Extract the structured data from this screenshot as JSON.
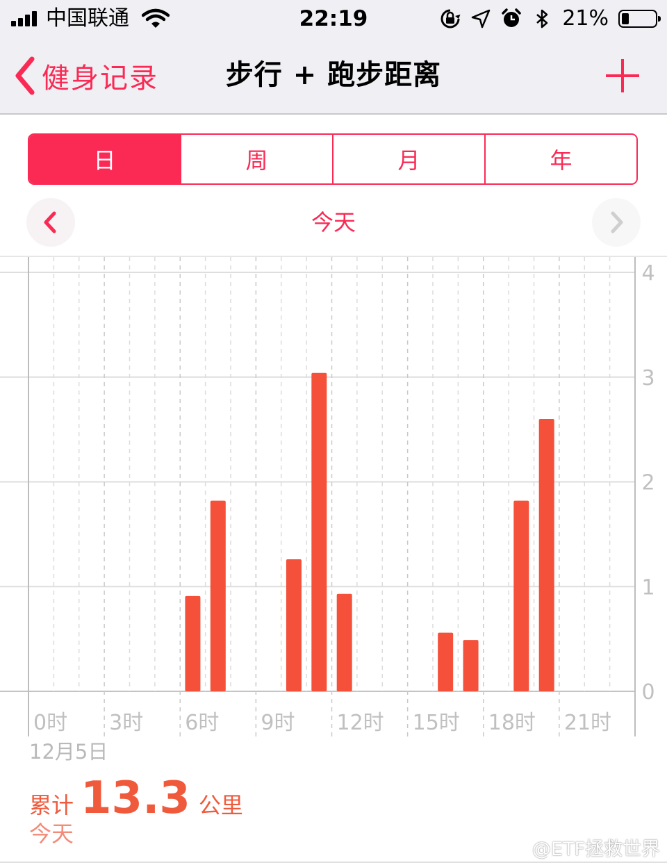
{
  "status_bar": {
    "carrier": "中国联通",
    "time": "22:19",
    "battery_percent": "21%",
    "battery_level": 0.21,
    "icons": [
      "signal-icon",
      "wifi-icon",
      "rotation-lock-icon",
      "location-icon",
      "alarm-icon",
      "bluetooth-icon",
      "battery-icon"
    ]
  },
  "nav": {
    "back_label": "健身记录",
    "title": "步行 + 跑步距离",
    "add_icon": "plus-icon"
  },
  "segments": [
    {
      "label": "日",
      "selected": true
    },
    {
      "label": "周",
      "selected": false
    },
    {
      "label": "月",
      "selected": false
    },
    {
      "label": "年",
      "selected": false
    }
  ],
  "date_nav": {
    "label": "今天",
    "prev_icon": "chevron-left-icon",
    "next_icon": "chevron-right-icon"
  },
  "chart_data": {
    "type": "bar",
    "x_unit": "hour",
    "xlim": [
      0,
      24
    ],
    "ylim": [
      0,
      4
    ],
    "yticks": [
      "0",
      "1",
      "2",
      "3",
      "4"
    ],
    "xtick_labels": [
      "0时",
      "3时",
      "6时",
      "9时",
      "12时",
      "15时",
      "18时",
      "21时"
    ],
    "x": [
      7,
      8,
      11,
      12,
      13,
      17,
      18,
      20,
      21
    ],
    "values": [
      0.91,
      1.82,
      1.26,
      3.04,
      0.93,
      0.56,
      0.49,
      1.82,
      2.6
    ],
    "bar_color": "#f4503a",
    "grid": true,
    "date": "12月5日"
  },
  "summary": {
    "label": "累计",
    "value": "13.3",
    "unit": "公里",
    "sub": "今天"
  },
  "watermark": "@ETF拯救世界",
  "colors": {
    "accent": "#fa2a55",
    "bar": "#f4503a",
    "summary": "#f05a3c"
  }
}
